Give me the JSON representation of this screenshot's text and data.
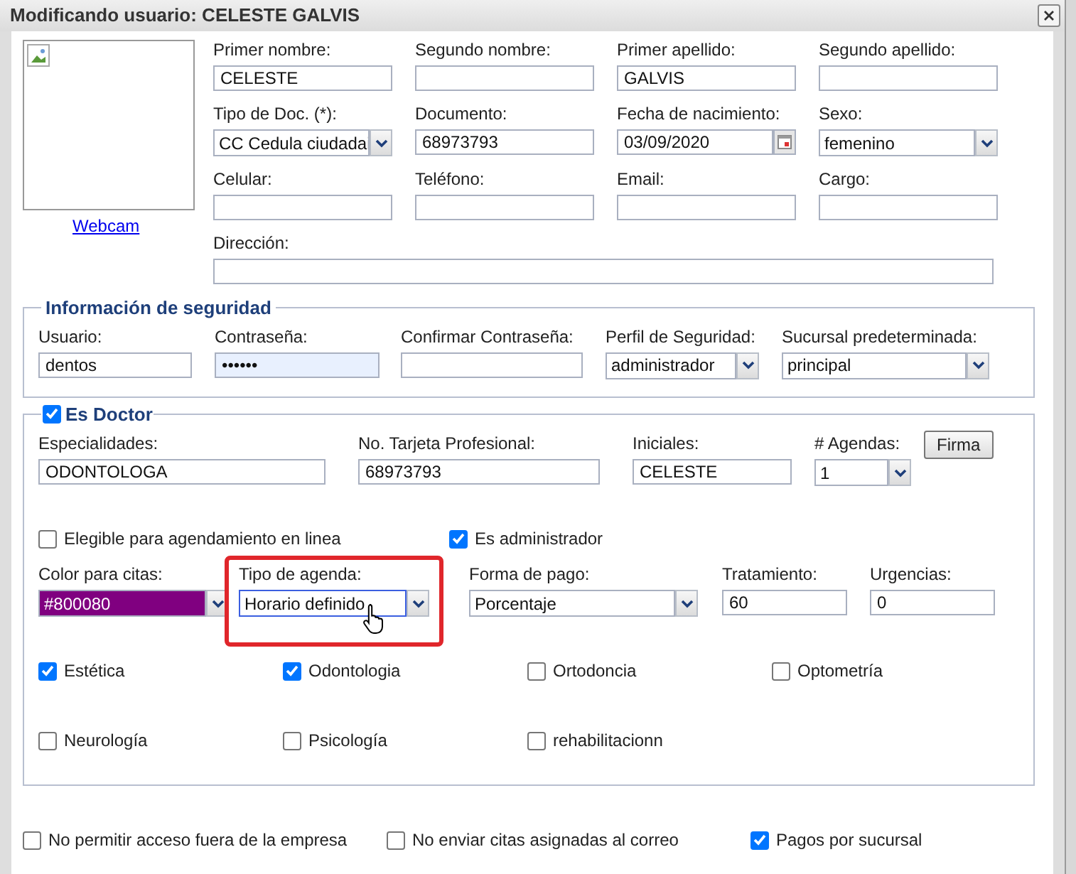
{
  "dialog": {
    "title": "Modificando usuario: CELESTE GALVIS"
  },
  "photo": {
    "link": "Webcam"
  },
  "personal_fields": [
    {
      "label": "Primer nombre:",
      "kind": "text",
      "value": "CELESTE"
    },
    {
      "label": "Segundo nombre:",
      "kind": "text"
    },
    {
      "label": "Primer apellido:",
      "kind": "text",
      "value": "GALVIS"
    },
    {
      "label": "Segundo apellido:",
      "kind": "text"
    },
    {
      "label": "Tipo de Doc. (*):",
      "kind": "select",
      "value": "CC Cedula ciudadai"
    },
    {
      "label": "Documento:",
      "kind": "text",
      "value": "68973793"
    },
    {
      "label": "Fecha de nacimiento:",
      "kind": "date",
      "value": "03/09/2020"
    },
    {
      "label": "Sexo:",
      "kind": "select",
      "value": "femenino"
    },
    {
      "label": "Celular:",
      "kind": "text"
    },
    {
      "label": "Teléfono:",
      "kind": "text"
    },
    {
      "label": "Email:",
      "kind": "text"
    },
    {
      "label": "Cargo:",
      "kind": "text"
    }
  ],
  "address": {
    "label": "Dirección:",
    "kind": "text"
  },
  "security": {
    "legend": "Información de seguridad",
    "fields": [
      {
        "label": "Usuario:",
        "kind": "text",
        "value": "dentos"
      },
      {
        "label": "Contraseña:",
        "kind": "password",
        "value": "••••••"
      },
      {
        "label": "Confirmar Contraseña:",
        "kind": "text"
      },
      {
        "label": "Perfil de Seguridad:",
        "kind": "select",
        "value": "administrador"
      },
      {
        "label": "Sucursal predeterminada:",
        "kind": "select",
        "value": "principal"
      }
    ]
  },
  "doctor": {
    "legend": "Es Doctor",
    "checked": true,
    "fields": [
      {
        "label": "Especialidades:",
        "kind": "text",
        "value": "ODONTOLOGA"
      },
      {
        "label": "No. Tarjeta Profesional:",
        "kind": "text",
        "value": "68973793"
      },
      {
        "label": "Iniciales:",
        "kind": "text",
        "value": "CELESTE"
      },
      {
        "label": "# Agendas:",
        "kind": "select",
        "value": "1"
      }
    ],
    "button": "Firma",
    "options": [
      {
        "label": "Elegible para agendamiento en linea",
        "checked": false
      },
      {
        "label": "Es administrador",
        "checked": true
      }
    ],
    "schedule_fields": [
      {
        "label": "Color para citas:",
        "kind": "color",
        "value": "#800080",
        "color": "#800080",
        "highlighted": false
      },
      {
        "label": "Tipo de agenda:",
        "kind": "select",
        "value": "Horario definido",
        "highlighted": true
      },
      {
        "label": "Forma de pago:",
        "kind": "select",
        "value": "Porcentaje",
        "highlighted": false
      },
      {
        "label": "Tratamiento:",
        "kind": "text",
        "value": "60",
        "highlighted": false
      },
      {
        "label": "Urgencias:",
        "kind": "text",
        "value": "0",
        "highlighted": false
      }
    ],
    "specialties": [
      {
        "label": "Estética",
        "checked": true
      },
      {
        "label": "Odontologia",
        "checked": true
      },
      {
        "label": "Ortodoncia",
        "checked": false
      },
      {
        "label": "Optometría",
        "checked": false
      },
      {
        "label": "Neurología",
        "checked": false
      },
      {
        "label": "Psicología",
        "checked": false
      },
      {
        "label": "rehabilitacionn",
        "checked": false
      }
    ]
  },
  "footer_options": [
    {
      "label": "No permitir acceso fuera de la empresa",
      "checked": false
    },
    {
      "label": "No enviar citas asignadas al correo",
      "checked": false
    },
    {
      "label": "Pagos por sucursal",
      "checked": true
    }
  ]
}
